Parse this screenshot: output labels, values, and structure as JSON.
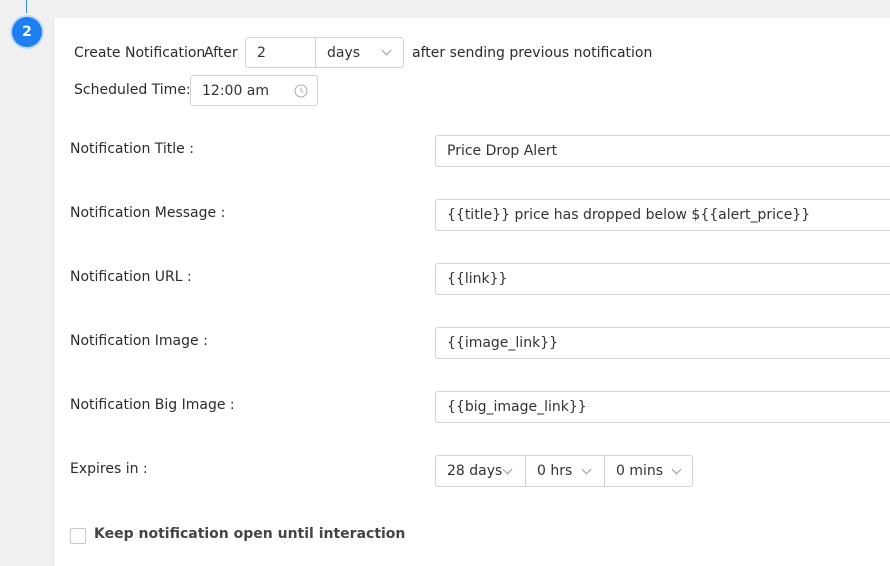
{
  "step": {
    "number": "2"
  },
  "schedule": {
    "create_label": "Create Notification",
    "after_label": "After",
    "after_value": "2",
    "unit_value": "days",
    "suffix_label": "after sending previous notification",
    "time_label": "Scheduled Time:",
    "time_value": "12:00 am"
  },
  "fields": [
    {
      "label": "Notification Title :",
      "value": "Price Drop Alert"
    },
    {
      "label": "Notification Message :",
      "value": "{{title}} price has dropped below ${{alert_price}}"
    },
    {
      "label": "Notification URL :",
      "value": "{{link}}"
    },
    {
      "label": "Notification Image :",
      "value": "{{image_link}}"
    },
    {
      "label": "Notification Big Image :",
      "value": "{{big_image_link}}"
    }
  ],
  "expires": {
    "label": "Expires in :",
    "days": "28 days",
    "hrs": "0 hrs",
    "mins": "0 mins"
  },
  "keep_open": {
    "label": "Keep notification open until interaction",
    "checked": false
  },
  "colors": {
    "accent": "#1e7ff0"
  }
}
